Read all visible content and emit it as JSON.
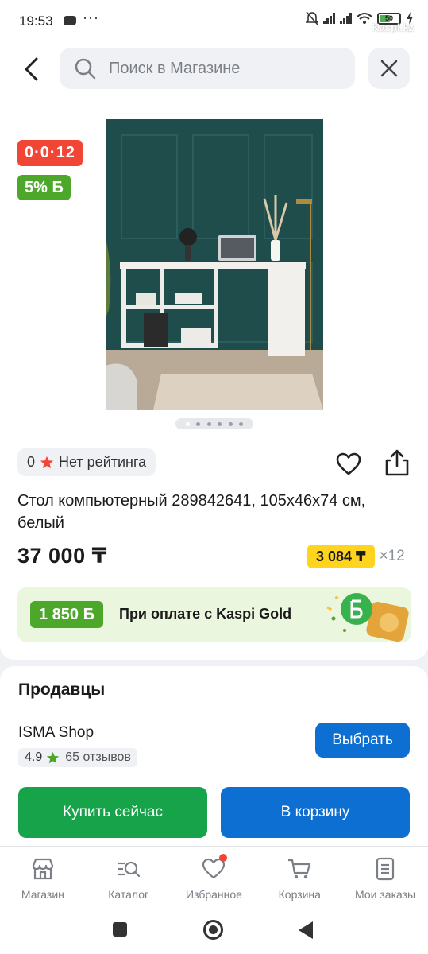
{
  "status_bar": {
    "time": "19:53",
    "dots": "···",
    "battery": "50",
    "watermark": "Kaspi.kz"
  },
  "search": {
    "placeholder": "Поиск в Магазине"
  },
  "badges": {
    "installment_plan": "0·0·12",
    "bonus_percent": "5% Б"
  },
  "gallery": {
    "image_count": 6,
    "active_index": 0
  },
  "rating": {
    "value": "0",
    "label": "Нет рейтинга"
  },
  "product": {
    "title": "Стол компьютерный 289842641, 105x46x74 см, белый",
    "price": "37 000 ₸",
    "monthly_payment": "3 084 ₸",
    "months": "×12"
  },
  "kaspi_gold": {
    "bonus": "1 850 Б",
    "text": "При оплате с Kaspi Gold"
  },
  "sellers": {
    "heading": "Продавцы",
    "shop_name": "ISMA Shop",
    "shop_rating": "4.9",
    "reviews": "65 отзывов",
    "choose_label": "Выбрать"
  },
  "actions": {
    "buy_now": "Купить сейчас",
    "add_to_cart": "В корзину"
  },
  "bottom_nav": [
    {
      "label": "Магазин",
      "icon": "shop-icon"
    },
    {
      "label": "Каталог",
      "icon": "catalog-icon"
    },
    {
      "label": "Избранное",
      "icon": "favorites-icon"
    },
    {
      "label": "Корзина",
      "icon": "cart-icon"
    },
    {
      "label": "Мои заказы",
      "icon": "orders-icon"
    }
  ],
  "colors": {
    "accent_blue": "#0d6fd1",
    "buy_green": "#17a34a",
    "badge_red": "#f14635",
    "badge_green": "#4ca72b",
    "installment_yellow": "#ffd41f"
  }
}
